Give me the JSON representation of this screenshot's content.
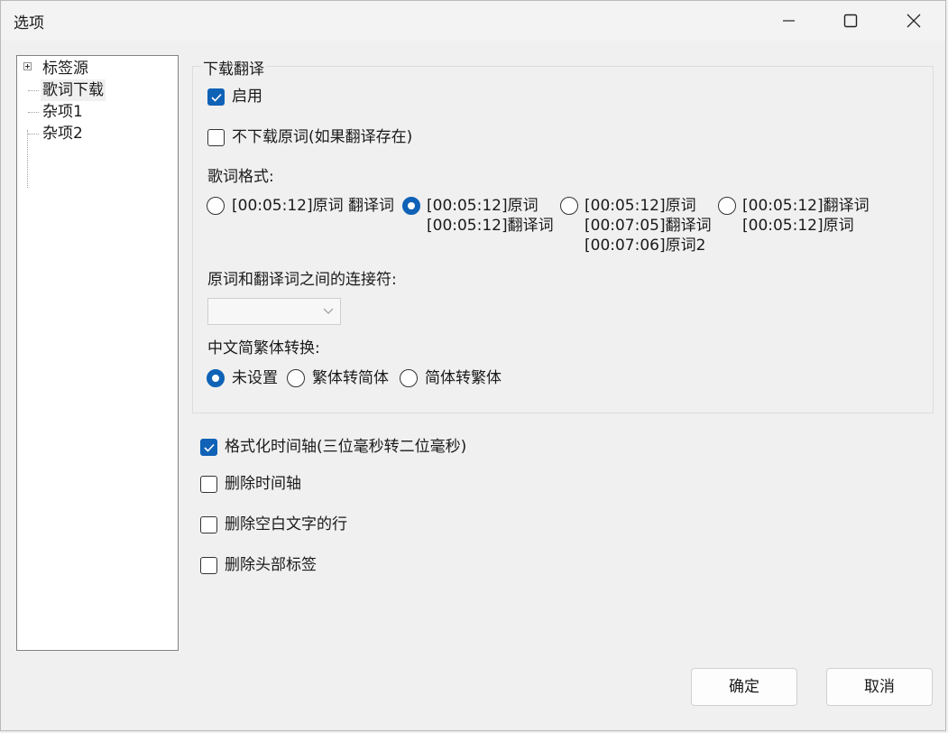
{
  "window": {
    "title": "选项"
  },
  "tree": {
    "items": [
      "标签源",
      "歌词下载",
      "杂项1",
      "杂项2"
    ]
  },
  "group": {
    "title": "下载翻译",
    "enable_label": "启用",
    "no_original_label": "不下载原词(如果翻译存在)",
    "format_label": "歌词格式:",
    "format_options": [
      {
        "line1": "[00:05:12]原词 翻译词",
        "line2": "",
        "line3": ""
      },
      {
        "line1": "[00:05:12]原词",
        "line2": "[00:05:12]翻译词",
        "line3": ""
      },
      {
        "line1": "[00:05:12]原词",
        "line2": "[00:07:05]翻译词",
        "line3": "[00:07:06]原词2"
      },
      {
        "line1": "[00:05:12]翻译词",
        "line2": "[00:05:12]原词",
        "line3": ""
      }
    ],
    "connector_label": "原词和翻译词之间的连接符:",
    "connector_value": "",
    "chinese_label": "中文简繁体转换:",
    "chinese_options": [
      "未设置",
      "繁体转简体",
      "简体转繁体"
    ]
  },
  "options": {
    "format_time": "格式化时间轴(三位毫秒转二位毫秒)",
    "remove_time": "删除时间轴",
    "remove_blank": "删除空白文字的行",
    "remove_header": "删除头部标签"
  },
  "buttons": {
    "ok": "确定",
    "cancel": "取消"
  },
  "state": {
    "selected_tree_item": "歌词下载",
    "enable_checked": true,
    "no_original_checked": false,
    "format_selected": 1,
    "chinese_selected": 0,
    "format_time_checked": true,
    "remove_time_checked": false,
    "remove_blank_checked": false,
    "remove_header_checked": false
  },
  "colors": {
    "accent": "#0f62b6"
  }
}
